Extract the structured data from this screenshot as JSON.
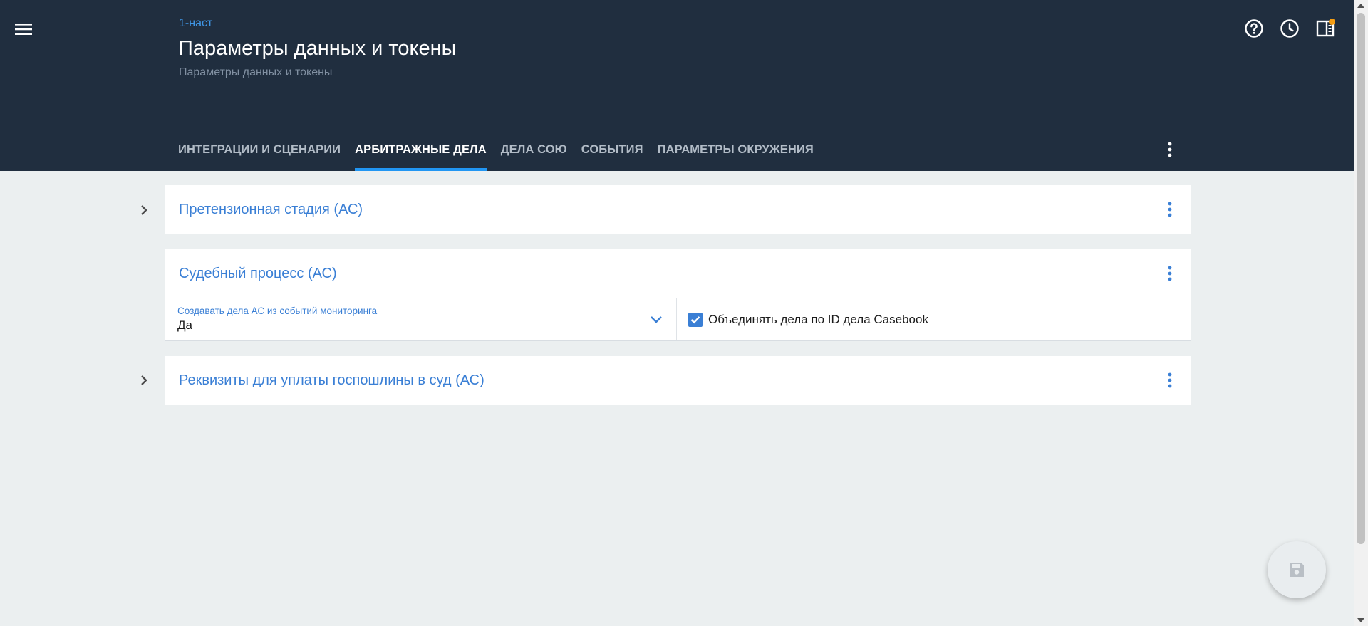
{
  "header": {
    "breadcrumb": "1-наст",
    "title": "Параметры данных и токены",
    "subtitle": "Параметры данных и токены",
    "icons": [
      "menu-icon",
      "help-icon",
      "history-icon",
      "panel-icon"
    ],
    "notification_color": "#f39c12"
  },
  "tabs": [
    {
      "label": "ИНТЕГРАЦИИ И СЦЕНАРИИ",
      "active": false
    },
    {
      "label": "АРБИТРАЖНЫЕ ДЕЛА",
      "active": true
    },
    {
      "label": "ДЕЛА СОЮ",
      "active": false
    },
    {
      "label": "СОБЫТИЯ",
      "active": false
    },
    {
      "label": "ПАРАМЕТРЫ ОКРУЖЕНИЯ",
      "active": false
    }
  ],
  "sections": [
    {
      "title": "Претензионная стадия (АС)",
      "expanded": false
    },
    {
      "title": "Судебный процесс (АС)",
      "expanded": true
    },
    {
      "title": "Реквизиты для уплаты госпошлины в суд (АС)",
      "expanded": false
    }
  ],
  "court_process": {
    "select_label": "Создавать дела АС из событий мониторинга",
    "select_value": "Да",
    "checkbox_label": "Объединять дела по ID дела Casebook",
    "checkbox_checked": true
  },
  "colors": {
    "header_bg": "#202e3f",
    "accent": "#3a7fd5",
    "tab_indicator": "#2196f3",
    "page_bg": "#ebeff0"
  }
}
